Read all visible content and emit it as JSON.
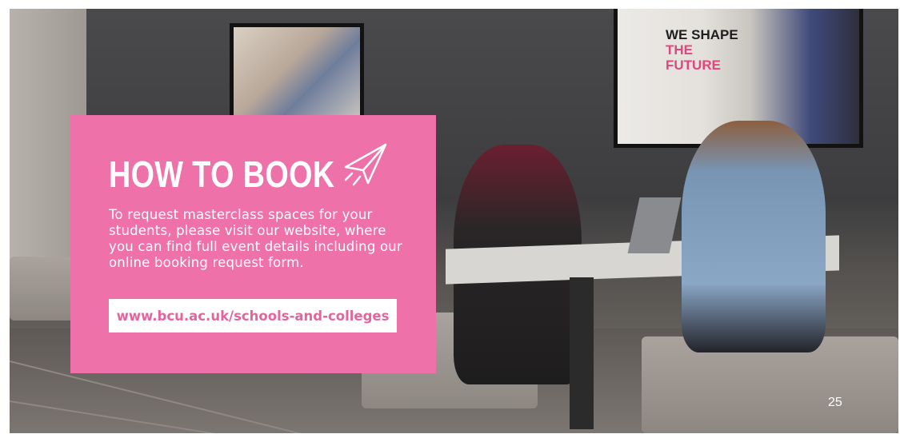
{
  "photo": {
    "screen_text_line1": "WE SHAPE",
    "screen_text_line2": "THE",
    "screen_text_line3": "FUTURE"
  },
  "card": {
    "title": "HOW TO BOOK",
    "icon": "paper-plane-icon",
    "body": "To request masterclass spaces for your students, please visit our website, where you can find full event details including our online booking request form.",
    "link_text": "www.bcu.ac.uk/schools-and-colleges"
  },
  "page_number": "25",
  "colors": {
    "card_background": "#ee71a9",
    "link_text": "#e5649e",
    "text": "#ffffff"
  }
}
